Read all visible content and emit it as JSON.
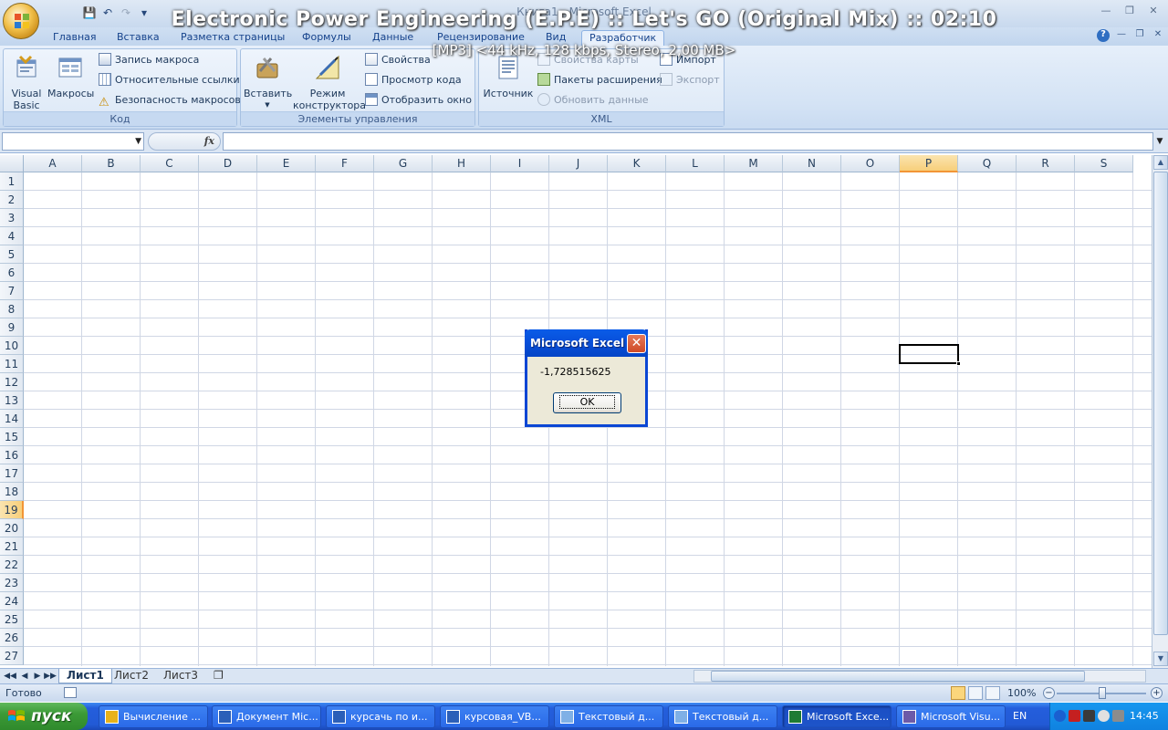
{
  "window": {
    "title": "Книга1 - Microsoft Excel"
  },
  "media_overlay": {
    "title": "Electronic Power Engineering (E.P.E) :: Let's GO (Original Mix) :: 02:10",
    "subtitle": "[MP3] <44 kHz, 128 kbps, Stereo, 2,00 MB>"
  },
  "ribbon": {
    "tabs": [
      "Главная",
      "Вставка",
      "Разметка страницы",
      "Формулы",
      "Данные",
      "Рецензирование",
      "Вид",
      "Разработчик"
    ],
    "active_tab": "Разработчик",
    "groups": {
      "code": {
        "label": "Код",
        "visual_basic": "Visual Basic",
        "macros": "Макросы",
        "record_macro": "Запись макроса",
        "relative_refs": "Относительные ссылки",
        "macro_security": "Безопасность макросов"
      },
      "controls": {
        "label": "Элементы управления",
        "insert": "Вставить",
        "design_mode": "Режим конструктора",
        "properties": "Свойства",
        "view_code": "Просмотр кода",
        "show_window": "Отобразить окно"
      },
      "xml": {
        "label": "XML",
        "source": "Источник",
        "map_properties": "Свойства карты",
        "expansion_packs": "Пакеты расширения",
        "refresh_data": "Обновить данные",
        "import": "Импорт",
        "export": "Экспорт"
      }
    }
  },
  "formula_bar": {
    "name_box": "",
    "fx": "fx",
    "value": ""
  },
  "sheet": {
    "columns": [
      "A",
      "B",
      "C",
      "D",
      "E",
      "F",
      "G",
      "H",
      "I",
      "J",
      "K",
      "L",
      "M",
      "N",
      "O",
      "P",
      "Q",
      "R",
      "S"
    ],
    "rows": [
      "1",
      "2",
      "3",
      "4",
      "5",
      "6",
      "7",
      "8",
      "9",
      "10",
      "11",
      "12",
      "13",
      "14",
      "15",
      "16",
      "17",
      "18",
      "19",
      "20",
      "21",
      "22",
      "23",
      "24",
      "25",
      "26",
      "27"
    ],
    "selected_column": "P",
    "selected_row": "19"
  },
  "sheet_tabs": [
    "Лист1",
    "Лист2",
    "Лист3"
  ],
  "active_sheet": "Лист1",
  "status": {
    "ready": "Готово",
    "zoom": "100%"
  },
  "dialog": {
    "title": "Microsoft Excel",
    "message": "-1,728515625",
    "ok": "OK"
  },
  "taskbar": {
    "start": "пуск",
    "items": [
      {
        "label": "Вычисление ...",
        "icon": "chrome-icon"
      },
      {
        "label": "Документ Mic...",
        "icon": "word-icon"
      },
      {
        "label": "курсачь по и...",
        "icon": "word-icon"
      },
      {
        "label": "курсовая_VB...",
        "icon": "word-icon"
      },
      {
        "label": "Текстовый д...",
        "icon": "notepad-icon"
      },
      {
        "label": "Текстовый д...",
        "icon": "notepad-icon"
      },
      {
        "label": "Microsoft Exce...",
        "icon": "excel-icon",
        "active": true
      },
      {
        "label": "Microsoft Visu...",
        "icon": "vb-icon"
      }
    ],
    "lang": "EN",
    "clock": "14:45"
  }
}
